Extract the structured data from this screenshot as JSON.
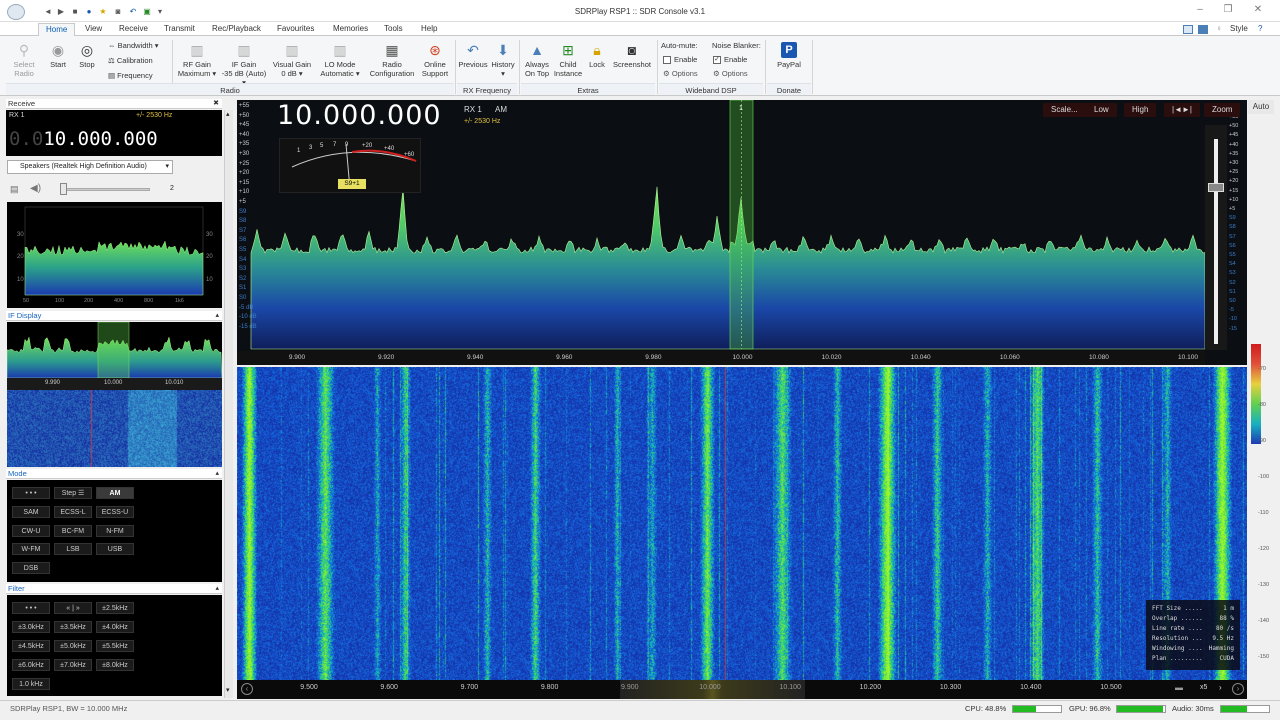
{
  "window": {
    "title": "SDRPlay RSP1 :: SDR Console v3.1"
  },
  "menu": {
    "tabs": [
      "Home",
      "View",
      "Receive",
      "Transmit",
      "Rec/Playback",
      "Favourites",
      "Memories",
      "Tools",
      "Help"
    ],
    "style_label": "Style"
  },
  "ribbon": {
    "select_radio": [
      "Select",
      "Radio"
    ],
    "start": "Start",
    "stop": "Stop",
    "bandwidth": "Bandwidth",
    "calibration": "Calibration",
    "frequency": "Frequency",
    "rf_gain": [
      "RF Gain",
      "Maximum"
    ],
    "if_gain": [
      "IF Gain",
      "-35 dB (Auto)"
    ],
    "visual_gain": [
      "Visual Gain",
      "0 dB"
    ],
    "lo_mode": [
      "LO Mode",
      "Automatic"
    ],
    "radio_config": [
      "Radio",
      "Configuration"
    ],
    "online_support": [
      "Online",
      "Support"
    ],
    "group_radio": "Radio",
    "previous": "Previous",
    "history": "History",
    "group_rx_freq": "RX Frequency",
    "always_on_top": [
      "Always",
      "On Top"
    ],
    "child_instance": [
      "Child",
      "Instance"
    ],
    "lock": "Lock",
    "screenshot": "Screenshot",
    "group_extras": "Extras",
    "auto_mute": "Auto-mute:",
    "auto_mute_enable": "Enable",
    "auto_mute_options": "Options",
    "noise_blanker": "Noise Blanker:",
    "nb_enable": "Enable",
    "nb_options": "Options",
    "group_wideband": "Wideband DSP",
    "paypal": "PayPal",
    "group_donate": "Donate"
  },
  "left": {
    "receive_header": "Receive",
    "rx_label": "RX 1",
    "bw_label": "+/- 2530 Hz",
    "freq_prefix": "0.0",
    "freq_main": "10.000.000",
    "audio_device": "Speakers (Realtek High Definition Audio)",
    "volume_value": "2",
    "audio_ticks": [
      "50",
      "100",
      "200",
      "400",
      "800",
      "1k6"
    ],
    "audio_db_left": [
      "30",
      "20",
      "10"
    ],
    "audio_db_right": [
      "30",
      "20",
      "10"
    ],
    "if_display_header": "IF Display",
    "if_ticks": [
      "9.990",
      "10.000",
      "10.010"
    ],
    "mode_header": "Mode",
    "modes": [
      [
        "• • •",
        "Step ☰",
        "AM"
      ],
      [
        "SAM",
        "ECSS-L",
        "ECSS-U"
      ],
      [
        "CW-U",
        "BC-FM",
        "N-FM"
      ],
      [
        "W-FM",
        "LSB",
        "USB"
      ],
      [
        "DSB"
      ]
    ],
    "selected_mode": "AM",
    "filter_header": "Filter",
    "filters": [
      [
        "• • •",
        "« | »",
        "±2.5kHz"
      ],
      [
        "±3.0kHz",
        "±3.5kHz",
        "±4.0kHz"
      ],
      [
        "±4.5kHz",
        "±5.0kHz",
        "±5.5kHz"
      ],
      [
        "±6.0kHz",
        "±7.0kHz",
        "±8.0kHz"
      ],
      [
        "1.0 kHz"
      ]
    ]
  },
  "spectrum": {
    "frequency": "10.000.000",
    "rx_label": "RX 1",
    "mode": "AM",
    "bw": "+/- 2530 Hz",
    "meter_scale": [
      "1",
      "3",
      "5",
      "7",
      "9",
      "+20",
      "+40",
      "+60"
    ],
    "smeter_reading": "S9+1",
    "buttons": [
      "Scale...",
      "Low",
      "High",
      "|◄►|",
      "Zoom"
    ],
    "auto_label": "Auto",
    "left_scale": [
      "+55",
      "+50",
      "+45",
      "+40",
      "+35",
      "+30",
      "+25",
      "+20",
      "+15",
      "+10",
      "+5",
      "S9",
      "S8",
      "S7",
      "S6",
      "S5",
      "S4",
      "S3",
      "S2",
      "S1",
      "S0",
      "-5 dB",
      "-10 dB",
      "-15 dB"
    ],
    "freq_ticks": [
      "9.900",
      "9.920",
      "9.940",
      "9.960",
      "9.980",
      "10.000",
      "10.020",
      "10.040",
      "10.060",
      "10.080",
      "10.100"
    ],
    "channel_marker": "1"
  },
  "waterfall": {
    "right_scale": [
      "-70",
      "-80",
      "-90",
      "-100",
      "-110",
      "-120",
      "-130",
      "-140",
      "-150"
    ],
    "bottom_ticks": [
      "9.500",
      "9.600",
      "9.700",
      "9.800",
      "9.900",
      "10.000",
      "10.100",
      "10.200",
      "10.300",
      "10.400",
      "10.500"
    ],
    "zoom_label": "x5",
    "fft": [
      [
        "FFT Size .....",
        "1 m"
      ],
      [
        "Overlap ......",
        "88 %"
      ],
      [
        "Line rate ....",
        "80 /s"
      ],
      [
        "Resolution ...",
        "9.5 Hz"
      ],
      [
        "Windowing ....",
        "Hamming"
      ],
      [
        "Plan .........",
        "CUDA"
      ]
    ]
  },
  "status": {
    "left": "SDRPlay RSP1, BW = 10.000 MHz",
    "cpu": "CPU: 48.8%",
    "cpu_pct": 48.8,
    "gpu": "GPU: 96.8%",
    "gpu_pct": 96.8,
    "audio": "Audio: 30ms",
    "audio_level": 0.55
  }
}
